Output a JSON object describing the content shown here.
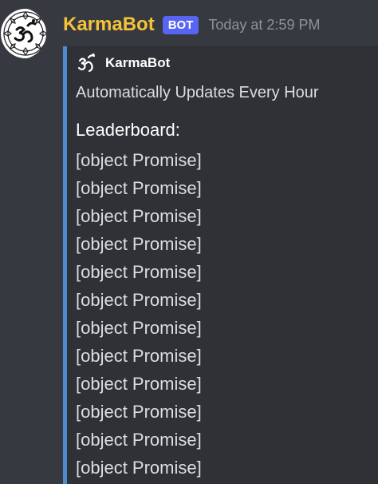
{
  "message": {
    "author": "KarmaBot",
    "tag": "BOT",
    "timestamp": "Today at 2:59 PM",
    "avatar_icon": "om-icon"
  },
  "embed": {
    "author_name": "KarmaBot",
    "author_icon": "om-icon",
    "accent_color": "#4f8ccf",
    "title": "Automatically Updates Every Hour",
    "field_name": "Leaderboard:",
    "entries": [
      "[object Promise]",
      "[object Promise]",
      "[object Promise]",
      "[object Promise]",
      "[object Promise]",
      "[object Promise]",
      "[object Promise]",
      "[object Promise]",
      "[object Promise]",
      "[object Promise]",
      "[object Promise]",
      "[object Promise]"
    ]
  },
  "colors": {
    "username": "#f5c33b",
    "bot_tag": "#5865f2",
    "background": "#36393f",
    "embed_background": "#2f3136"
  }
}
